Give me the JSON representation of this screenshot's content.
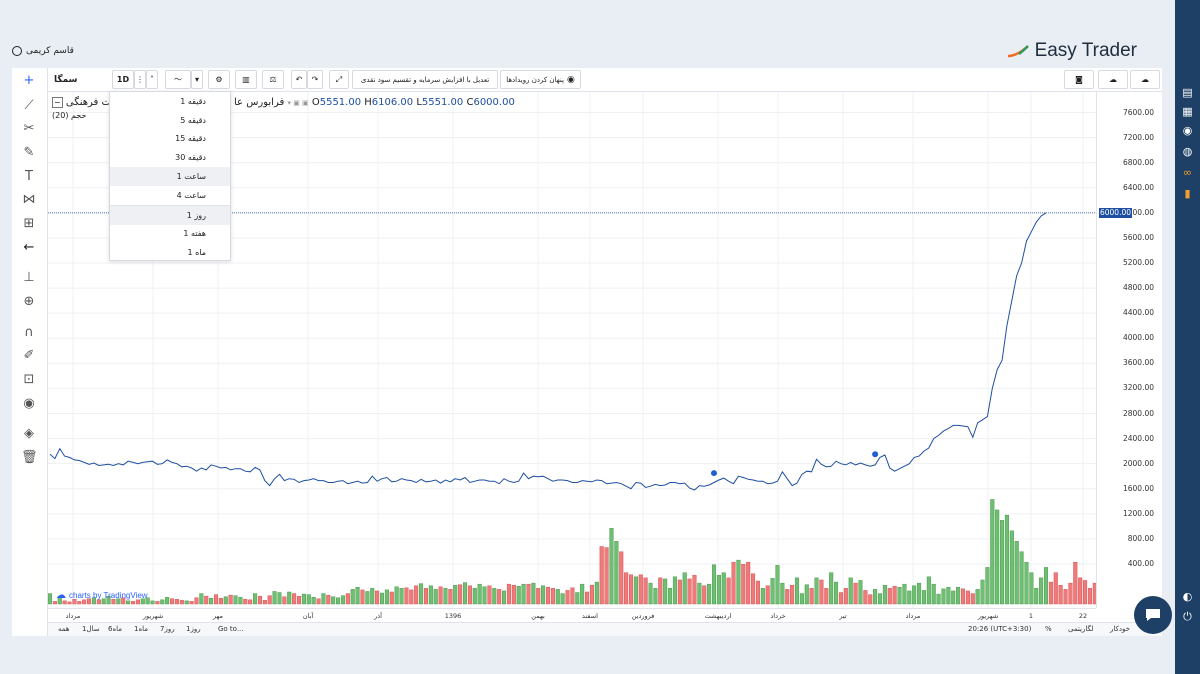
{
  "user": {
    "name": "قاسم کریمی"
  },
  "brand": {
    "name": "Easy Trader"
  },
  "toolbar": {
    "symbol": "سمگا",
    "interval": "1D",
    "adjust_button": "تعدیل با افزایش سرمایه و تقسیم سود نقدی",
    "hide_events_button": "پنهان کردن رویدادها"
  },
  "legend": {
    "name": "فرابورس عا",
    "company": "ات فرهنگی",
    "volume": "حجم (20)",
    "O": "5551.00",
    "H": "6106.00",
    "L": "5551.00",
    "C": "6000.00",
    "o_label": "O",
    "h_label": "H",
    "l_label": "L",
    "c_label": "C"
  },
  "interval_menu": [
    {
      "label": "دقیقه 1",
      "highlight": false
    },
    {
      "label": "دقیقه 5",
      "highlight": false
    },
    {
      "label": "دقیقه 15",
      "highlight": false
    },
    {
      "label": "دقیقه 30",
      "highlight": false
    },
    {
      "label": "ساعت 1",
      "highlight": true
    },
    {
      "label": "ساعت 4",
      "highlight": false
    },
    {
      "label": "روز 1",
      "highlight": true
    },
    {
      "label": "هفته 1",
      "highlight": false
    },
    {
      "label": "ماه 1",
      "highlight": false
    }
  ],
  "price_axis": [
    "7600.00",
    "7200.00",
    "6800.00",
    "6400.00",
    "6000.00",
    "5600.00",
    "5200.00",
    "4800.00",
    "4400.00",
    "4000.00",
    "3600.00",
    "3200.00",
    "2800.00",
    "2400.00",
    "2000.00",
    "1600.00",
    "1200.00",
    "800.00",
    "400.00"
  ],
  "last_price": "6000.00",
  "time_axis": [
    {
      "label": "مرداد",
      "pos": 0.025
    },
    {
      "label": "شهریور",
      "pos": 0.105
    },
    {
      "label": "مهر",
      "pos": 0.17
    },
    {
      "label": "آبان",
      "pos": 0.26
    },
    {
      "label": "آذر",
      "pos": 0.33
    },
    {
      "label": "1396",
      "pos": 0.405
    },
    {
      "label": "بهمن",
      "pos": 0.49
    },
    {
      "label": "اسفند",
      "pos": 0.542
    },
    {
      "label": "فروردین",
      "pos": 0.595
    },
    {
      "label": "اردیبهشت",
      "pos": 0.67
    },
    {
      "label": "خرداد",
      "pos": 0.73
    },
    {
      "label": "تیر",
      "pos": 0.795
    },
    {
      "label": "مرداد",
      "pos": 0.865
    },
    {
      "label": "شهریور",
      "pos": 0.94
    },
    {
      "label": "1",
      "pos": 0.983
    },
    {
      "label": "22",
      "pos": 1.035
    }
  ],
  "attribution": "charts by TradingView",
  "bottom": {
    "ranges": [
      "همه",
      "1سال",
      "6ماه",
      "1ماه",
      "7روز",
      "1روز"
    ],
    "goto": "Go to...",
    "time": "20:26 (UTC+3:30)",
    "percent": "%",
    "log": "لگاریتمی",
    "auto": "خودکار"
  },
  "chart_data": {
    "type": "line",
    "ylim": [
      0,
      7800
    ],
    "close": [
      2150,
      2080,
      2240,
      2120,
      2100,
      2060,
      2050,
      2020,
      1990,
      2010,
      1970,
      1980,
      1990,
      1970,
      2000,
      1980,
      2040,
      2020,
      2000,
      2020,
      2030,
      2040,
      1990,
      2000,
      2060,
      2020,
      2000,
      1950,
      1960,
      1930,
      1880,
      1930,
      1900,
      1980,
      1960,
      1930,
      1940,
      1900,
      1920,
      1920,
      1880,
      1870,
      1940,
      1900,
      1730,
      1650,
      1760,
      1830,
      1730,
      1760,
      1750,
      1700,
      1730,
      1740,
      1760,
      1730,
      1730,
      1700,
      1700,
      1720,
      1730,
      1680,
      1700,
      1720,
      1690,
      1700,
      1800,
      1720,
      1760,
      1780,
      1710,
      1720,
      1760,
      1740,
      1730,
      1700,
      1750,
      1710,
      1720,
      1740,
      1690,
      1740,
      1710,
      1760,
      1740,
      1780,
      1700,
      1720,
      1740,
      1740,
      1720,
      1720,
      1680,
      1760,
      1720,
      1700,
      1720,
      1850,
      1760,
      1800,
      1790,
      1800,
      1760,
      1720,
      1740,
      1740,
      1730,
      1700,
      1700,
      1730,
      1720,
      1710,
      1740,
      1730,
      1680,
      1690,
      1700,
      1680,
      1640,
      1600,
      1700,
      1690,
      1620,
      1640,
      1670,
      1650,
      1660,
      1700,
      1700,
      1680,
      1690,
      1610,
      1580,
      1650,
      1640,
      1660,
      1700,
      1740,
      1770,
      1720,
      1680,
      1800,
      1780,
      1750,
      1740,
      1720,
      1720,
      1680,
      1690,
      1720,
      1870,
      1760,
      1650,
      1690,
      1830,
      1880,
      1870,
      2070,
      1990,
      1950,
      1960,
      2040,
      2000,
      1980,
      2020,
      1980,
      2010,
      1980,
      1960,
      1980,
      2100,
      2140,
      1930,
      1880,
      1920,
      1960,
      2000,
      2100,
      2120,
      2200,
      2250,
      2400,
      2450,
      2520,
      2560,
      2610,
      2610,
      2600,
      2590,
      2420,
      2650,
      2700,
      2750,
      3200,
      3500,
      3650,
      4200,
      4600,
      5000,
      5200,
      5550,
      5700,
      5850,
      5950,
      6000
    ],
    "volume": [
      200,
      50,
      150,
      60,
      40,
      90,
      50,
      80,
      100,
      120,
      80,
      100,
      150,
      90,
      100,
      120,
      60,
      50,
      80,
      100,
      120,
      60,
      50,
      80,
      130,
      100,
      90,
      70,
      60,
      50,
      120,
      200,
      150,
      110,
      180,
      110,
      140,
      170,
      160,
      130,
      90,
      80,
      200,
      150,
      70,
      160,
      240,
      220,
      140,
      230,
      200,
      150,
      190,
      180,
      130,
      100,
      200,
      170,
      140,
      120,
      160,
      200,
      280,
      320,
      270,
      240,
      300,
      250,
      210,
      270,
      230,
      330,
      300,
      310,
      270,
      350,
      390,
      300,
      350,
      280,
      330,
      300,
      280,
      360,
      370,
      410,
      350,
      300,
      380,
      330,
      350,
      300,
      280,
      250,
      380,
      360,
      340,
      380,
      380,
      400,
      300,
      350,
      320,
      300,
      280,
      200,
      260,
      310,
      220,
      380,
      230,
      360,
      420,
      1100,
      1080,
      1450,
      1200,
      1000,
      600,
      560,
      520,
      560,
      500,
      400,
      300,
      500,
      480,
      300,
      520,
      460,
      600,
      480,
      550,
      400,
      350,
      380,
      750,
      550,
      600,
      500,
      800,
      840,
      760,
      800,
      580,
      440,
      300,
      350,
      490,
      740,
      400,
      280,
      360,
      500,
      200,
      370,
      300,
      500,
      460,
      300,
      600,
      420,
      220,
      300,
      500,
      400,
      450,
      260,
      180,
      280,
      200,
      360,
      300,
      340,
      320,
      380,
      250,
      350,
      400,
      260,
      520,
      380,
      190,
      290,
      320,
      250,
      320,
      290,
      250,
      200,
      280,
      460,
      700,
      2000,
      1800,
      1600,
      1700,
      1400,
      1200,
      1000,
      800,
      600,
      300,
      500,
      700,
      420,
      600,
      360,
      280,
      400,
      800,
      500,
      450,
      300,
      400,
      600,
      600,
      900,
      1000,
      1500,
      2200,
      1400,
      600,
      900,
      1600,
      1000,
      700,
      500,
      200,
      700,
      800,
      1000,
      1400,
      1800,
      1300,
      1900,
      1200,
      1000,
      1200,
      800,
      1900,
      1300
    ]
  }
}
